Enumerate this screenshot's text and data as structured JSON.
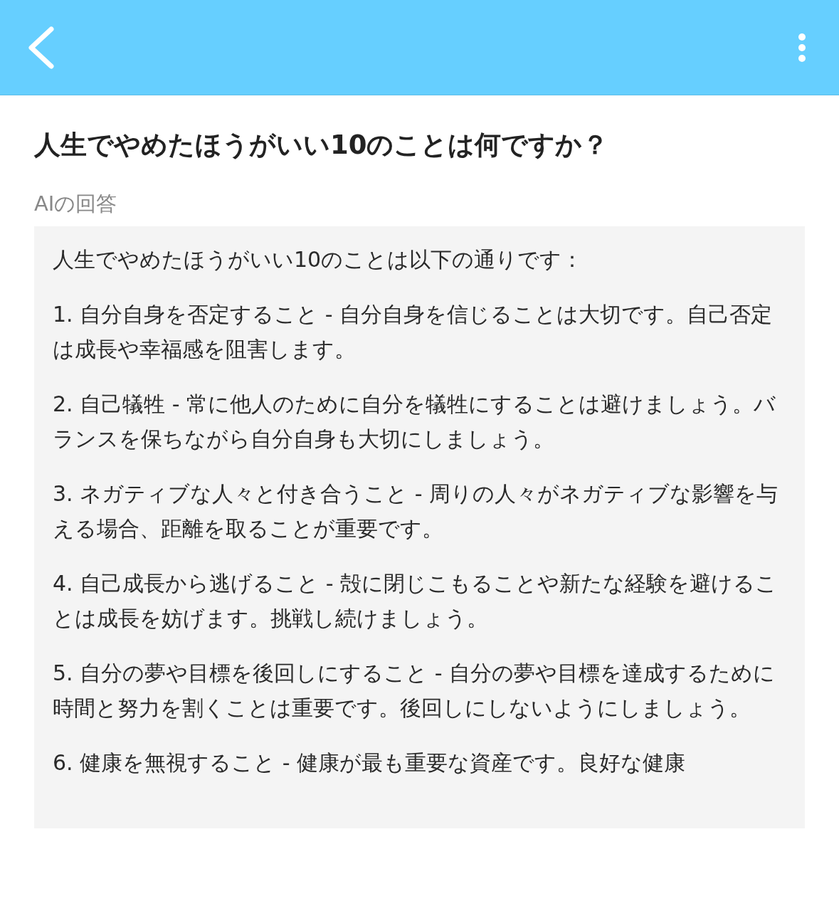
{
  "question": "人生でやめたほうがいい10のことは何ですか？",
  "answer_label": "AIの回答",
  "answer": {
    "paragraphs": [
      "人生でやめたほうがいい10のことは以下の通りです：",
      "1. 自分自身を否定すること - 自分自身を信じることは大切です。自己否定は成長や幸福感を阻害します。",
      "2. 自己犠牲 - 常に他人のために自分を犠牲にすることは避けましょう。バランスを保ちながら自分自身も大切にしましょう。",
      "3. ネガティブな人々と付き合うこと - 周りの人々がネガティブな影響を与える場合、距離を取ることが重要です。",
      "4. 自己成長から逃げること - 殻に閉じこもることや新たな経験を避けることは成長を妨げます。挑戦し続けましょう。",
      "5. 自分の夢や目標を後回しにすること - 自分の夢や目標を達成するために時間と努力を割くことは重要です。後回しにしないようにしましょう。",
      "6. 健康を無視すること - 健康が最も重要な資産です。良好な健康"
    ]
  }
}
